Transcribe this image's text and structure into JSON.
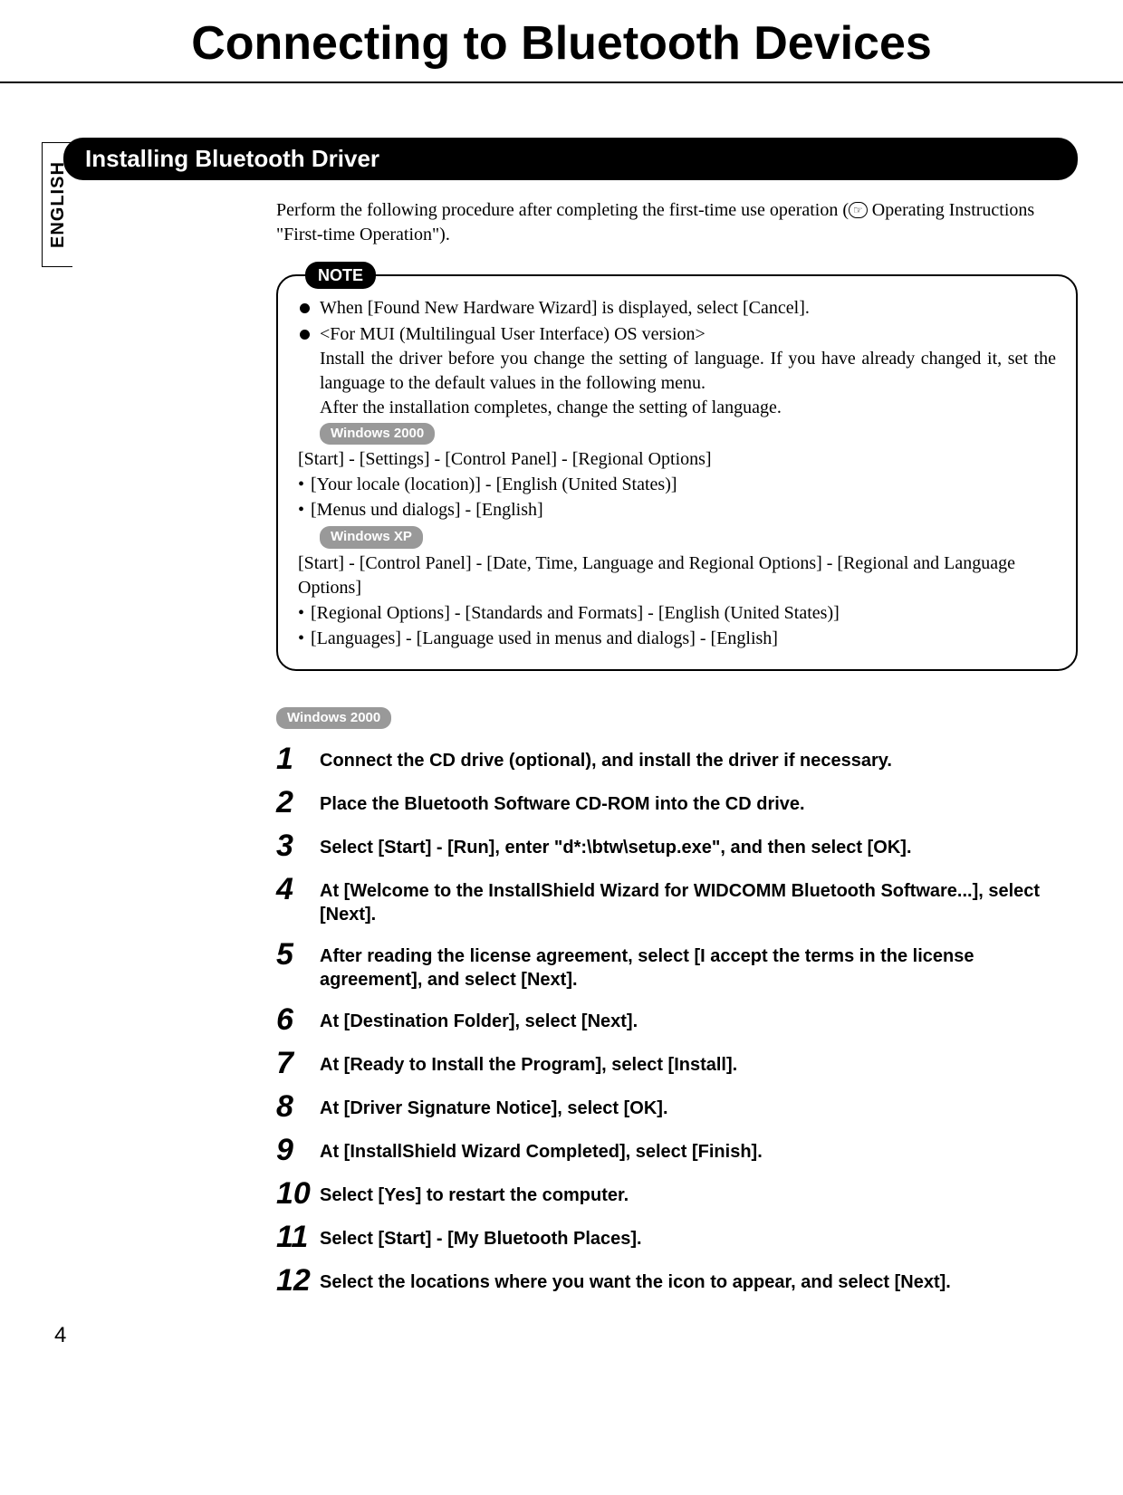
{
  "page_title": "Connecting to Bluetooth Devices",
  "language_tab": "ENGLISH",
  "section_heading": "Installing Bluetooth Driver",
  "intro_para_line1": "Perform the following procedure after completing the first-time use operation (",
  "intro_ref_icon": "☞",
  "intro_para_line2": " Operating Instructions \"First-time Operation\").",
  "note_label": "NOTE",
  "note_item1": "When [Found New Hardware Wizard] is displayed, select [Cancel].",
  "note_item2_heading": "<For MUI (Multilingual User Interface) OS version>",
  "note_item2_l1": "Install the driver before you change the setting of language. If you have already changed it, set the language to the default values in the following menu.",
  "note_item2_l2": "After the installation completes, change the setting of language.",
  "os_pill_2000": "Windows 2000",
  "note_2000_path": "[Start] - [Settings] - [Control Panel] - [Regional Options]",
  "note_2000_b1": "[Your locale (location)] - [English (United States)]",
  "note_2000_b2": "[Menus und dialogs] - [English]",
  "os_pill_xp": "Windows XP",
  "note_xp_path": "[Start] - [Control Panel] - [Date, Time, Language and Regional Options] - [Regional and Language Options]",
  "note_xp_b1": "[Regional Options] - [Standards and Formats] - [English (United States)]",
  "note_xp_b2": "[Languages] - [Language used in menus and dialogs] - [English]",
  "steps": [
    {
      "n": "1",
      "t": "Connect the CD drive (optional), and install the driver if necessary."
    },
    {
      "n": "2",
      "t": "Place the Bluetooth Software CD-ROM into the CD drive."
    },
    {
      "n": "3",
      "t": "Select [Start] - [Run], enter \"d*:\\btw\\setup.exe\", and then select [OK]."
    },
    {
      "n": "4",
      "t": "At [Welcome to the InstallShield Wizard for WIDCOMM Bluetooth Software...], select [Next]."
    },
    {
      "n": "5",
      "t": "After reading the license agreement, select [I accept the terms in the license agreement], and select [Next]."
    },
    {
      "n": "6",
      "t": "At [Destination Folder], select [Next]."
    },
    {
      "n": "7",
      "t": "At [Ready to Install the Program], select [Install]."
    },
    {
      "n": "8",
      "t": "At [Driver Signature Notice], select [OK]."
    },
    {
      "n": "9",
      "t": "At [InstallShield Wizard Completed], select [Finish]."
    },
    {
      "n": "10",
      "t": "Select [Yes] to restart the computer."
    },
    {
      "n": "11",
      "t": "Select [Start] - [My Bluetooth Places]."
    },
    {
      "n": "12",
      "t": "Select the locations where you want the icon to appear, and select [Next]."
    }
  ],
  "page_number": "4"
}
